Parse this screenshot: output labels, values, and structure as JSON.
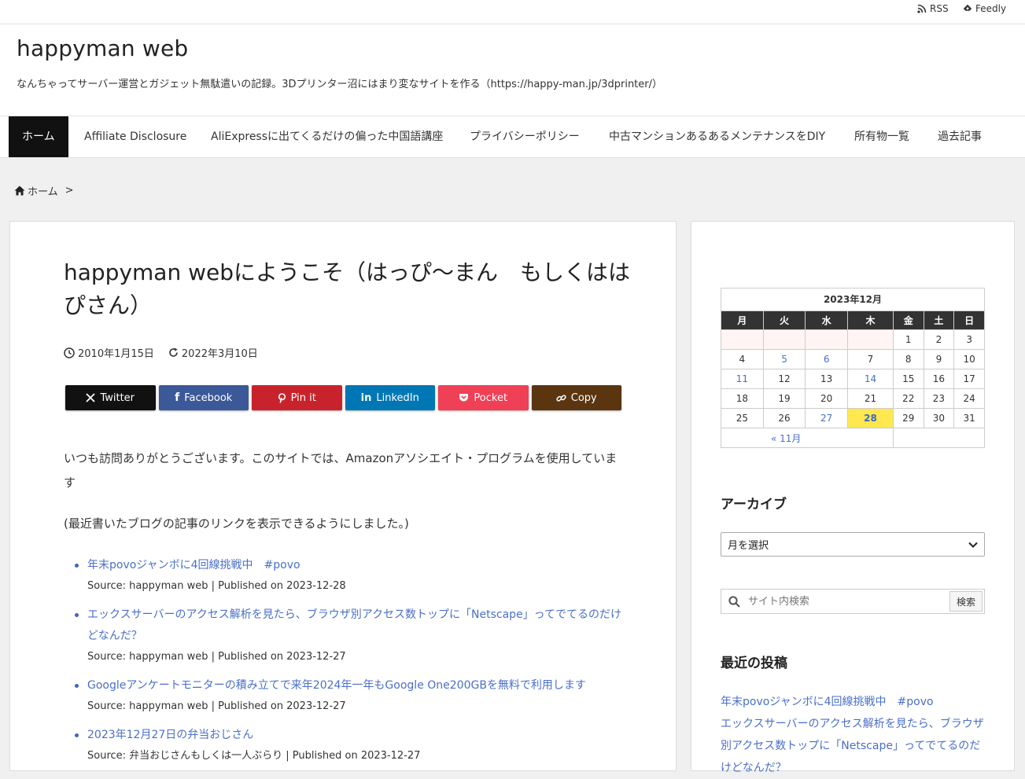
{
  "topbar": {
    "rss": "RSS",
    "feedly": "Feedly"
  },
  "site": {
    "title": "happyman web",
    "description": "なんちゃってサーバー運営とガジェット無駄遣いの記録。3Dプリンター沼にはまり変なサイトを作る（https://happy-man.jp/3dprinter/）"
  },
  "nav": {
    "items": [
      {
        "label": "ホーム"
      },
      {
        "label": "Affiliate Disclosure"
      },
      {
        "label": "AliExpressに出てくるだけの偏った中国語講座"
      },
      {
        "label": "プライバシーポリシー"
      },
      {
        "label": "中古マンションあるあるメンテナンスをDIY"
      },
      {
        "label": "所有物一覧"
      },
      {
        "label": "過去記事"
      }
    ]
  },
  "breadcrumb": {
    "home": "ホーム",
    "separator": ">"
  },
  "article": {
    "title": "happyman webにようこそ（はっぴ〜まん　もしくははぴさん）",
    "published": "2010年1月15日",
    "updated": "2022年3月10日",
    "share": [
      {
        "label": "Twitter",
        "color": "#111111"
      },
      {
        "label": "Facebook",
        "color": "#3b5998"
      },
      {
        "label": "Pin it",
        "color": "#c8232c"
      },
      {
        "label": "LinkedIn",
        "color": "#0077b5"
      },
      {
        "label": "Pocket",
        "color": "#ef4056"
      },
      {
        "label": "Copy",
        "color": "#5a3510"
      }
    ],
    "intro": "いつも訪問ありがとうございます。このサイトでは、Amazonアソシエイト・プログラムを使用しています",
    "note": "(最近書いたブログの記事のリンクを表示できるようにしました。)",
    "posts": [
      {
        "title": "年末povoジャンボに4回線挑戦中　#povo",
        "meta": "Source: happyman web | Published on 2023-12-28"
      },
      {
        "title": "エックスサーバーのアクセス解析を見たら、ブラウザ別アクセス数トップに「Netscape」ってでてるのだけどなんだ？",
        "meta": "Source: happyman web | Published on 2023-12-27"
      },
      {
        "title": "Googleアンケートモニターの積み立てで来年2024年一年もGoogle One200GBを無料で利用します",
        "meta": "Source: happyman web | Published on 2023-12-27"
      },
      {
        "title": "2023年12月27日の弁当おじさん",
        "meta": "Source: 弁当おじさんもしくは一人ぶらり | Published on 2023-12-27"
      }
    ]
  },
  "sidebar": {
    "calendar": {
      "caption": "2023年12月",
      "weekdays": [
        "月",
        "火",
        "水",
        "木",
        "金",
        "土",
        "日"
      ],
      "weeks": [
        [
          "",
          "",
          "",
          "",
          "1",
          "2",
          "3"
        ],
        [
          "4",
          "5",
          "6",
          "7",
          "8",
          "9",
          "10"
        ],
        [
          "11",
          "12",
          "13",
          "14",
          "15",
          "16",
          "17"
        ],
        [
          "18",
          "19",
          "20",
          "21",
          "22",
          "23",
          "24"
        ],
        [
          "25",
          "26",
          "27",
          "28",
          "29",
          "30",
          "31"
        ]
      ],
      "linked_days": [
        "5",
        "6",
        "11",
        "14",
        "27",
        "28"
      ],
      "today": "28",
      "prev": "« 11月"
    },
    "archive": {
      "title": "アーカイブ",
      "select": "月を選択"
    },
    "search": {
      "placeholder": "サイト内検索",
      "button": "検索"
    },
    "recent": {
      "title": "最近の投稿",
      "items": [
        "年末povoジャンボに4回線挑戦中　#povo",
        "エックスサーバーのアクセス解析を見たら、ブラウザ別アクセス数トップに「Netscape」ってでてるのだけどなんだ？"
      ]
    }
  }
}
